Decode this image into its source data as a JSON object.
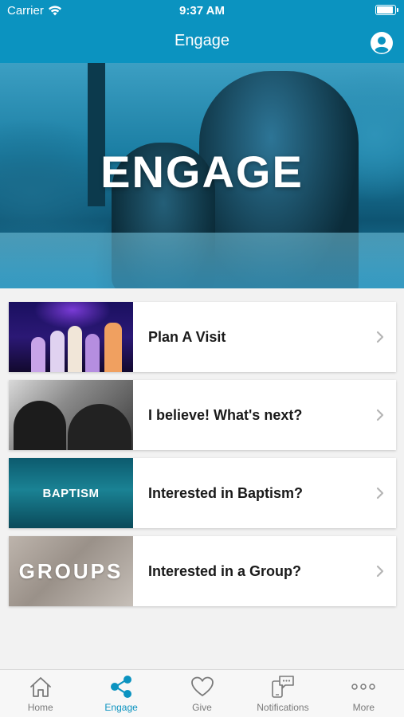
{
  "status_bar": {
    "carrier": "Carrier",
    "time": "9:37 AM"
  },
  "nav": {
    "title": "Engage"
  },
  "hero": {
    "title": "ENGAGE"
  },
  "cards": [
    {
      "label": "Plan A Visit",
      "thumb_text": ""
    },
    {
      "label": "I believe! What's next?",
      "thumb_text": ""
    },
    {
      "label": "Interested in Baptism?",
      "thumb_text": "BAPTISM"
    },
    {
      "label": "Interested in a Group?",
      "thumb_text": "GROUPS"
    }
  ],
  "tabs": [
    {
      "label": "Home",
      "icon": "home-icon"
    },
    {
      "label": "Engage",
      "icon": "share-icon"
    },
    {
      "label": "Give",
      "icon": "heart-icon"
    },
    {
      "label": "Notifications",
      "icon": "notifications-icon"
    },
    {
      "label": "More",
      "icon": "more-icon"
    }
  ],
  "colors": {
    "brand": "#0b93c0",
    "tab_inactive": "#7a7a7a"
  },
  "active_tab": "Engage"
}
